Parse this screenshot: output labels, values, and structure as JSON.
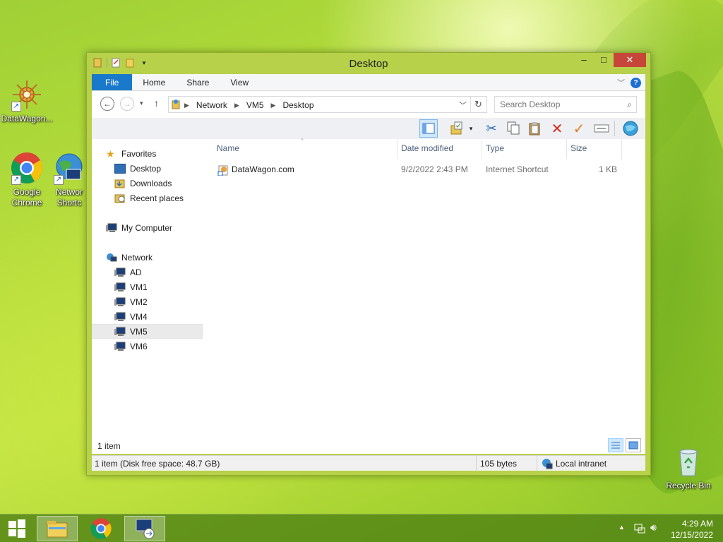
{
  "desktop": {
    "icons": [
      {
        "label": "DataWagon...",
        "icon": "datawagon-icon"
      },
      {
        "label": "Google Chrome",
        "icon": "chrome-icon"
      },
      {
        "label": "Network Shortcut",
        "label_visible": "Networ Shortc",
        "icon": "network-shortcut-icon"
      },
      {
        "label": "Recycle Bin",
        "icon": "recycle-bin-icon"
      }
    ]
  },
  "window": {
    "title": "Desktop",
    "ribbon_tabs": [
      "File",
      "Home",
      "Share",
      "View"
    ],
    "breadcrumb": [
      "Network",
      "VM5",
      "Desktop"
    ],
    "search_placeholder": "Search Desktop",
    "navpane": {
      "favorites": "Favorites",
      "favorite_items": [
        "Desktop",
        "Downloads",
        "Recent places"
      ],
      "my_computer": "My Computer",
      "network": "Network",
      "network_items": [
        "AD",
        "VM1",
        "VM2",
        "VM4",
        "VM5",
        "VM6"
      ],
      "selected": "VM5"
    },
    "columns": [
      "Name",
      "Date modified",
      "Type",
      "Size"
    ],
    "files": [
      {
        "name": "DataWagon.com",
        "date_modified": "9/2/2022 2:43 PM",
        "type": "Internet Shortcut",
        "size": "1 KB"
      }
    ],
    "item_count": "1 item",
    "status": {
      "free_space": "1 item (Disk free space: 48.7 GB)",
      "bytes": "105 bytes",
      "zone": "Local intranet"
    }
  },
  "taskbar": {
    "time": "4:29 AM",
    "date": "12/15/2022"
  },
  "colors": {
    "file_tab": "#1979ca",
    "close_button": "#c7463a",
    "window_frame": "#b7d14a"
  }
}
